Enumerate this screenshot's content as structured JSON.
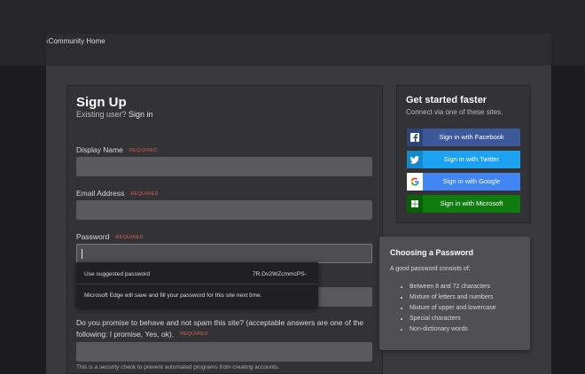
{
  "nav": {
    "back_label": "Community Home"
  },
  "signup": {
    "title": "Sign Up",
    "existing_prefix": "Existing user?",
    "existing_link": "Sign in",
    "required_label": "REQUIRED",
    "fields": {
      "display_name": {
        "label": "Display Name",
        "value": ""
      },
      "email": {
        "label": "Email Address",
        "value": ""
      },
      "password": {
        "label": "Password",
        "value": ""
      }
    },
    "question": {
      "text": "Do you promise to behave and not spam this site? (acceptable answers are one of the following: I promise, Yes, ok).",
      "value": ""
    },
    "hint": "This is a security check to prevent automated programs from creating accounts."
  },
  "password_suggestion": {
    "use_label": "Use suggested password",
    "suggested_value": "7R.Dv2WZcmmcPS-",
    "edge_note": "Microsoft Edge will save and fill your password for this site next time."
  },
  "sidebar": {
    "title": "Get started faster",
    "subtitle": "Connect via one of these sites.",
    "buttons": {
      "facebook": "Sign in with Facebook",
      "twitter": "Sign in with Twitter",
      "google": "Sign in with Google",
      "microsoft": "Sign in with Microsoft"
    }
  },
  "password_tips": {
    "title": "Choosing a Password",
    "intro": "A good password consists of:",
    "items": [
      "Between 8 and 72 characters",
      "Mixture of letters and numbers",
      "Mixture of upper and lowercase",
      "Special characters",
      "Non-dictionary words"
    ]
  },
  "colors": {
    "facebook": "#3b5998",
    "twitter": "#1da1f2",
    "google": "#4285f4",
    "microsoft": "#107c10",
    "required": "#e05a5a"
  }
}
